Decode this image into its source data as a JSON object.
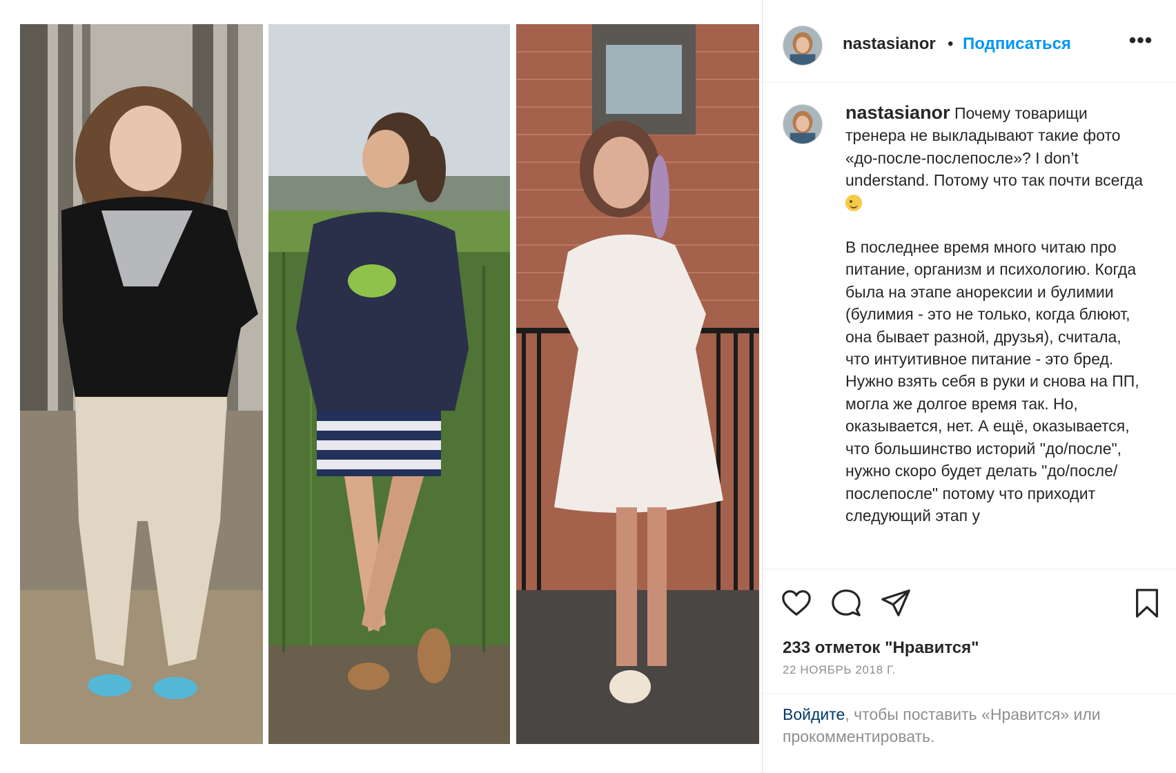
{
  "post": {
    "username": "nastasianor",
    "separator": "•",
    "follow_label": "Подписаться",
    "more_icon": "more-options-icon",
    "more_label": "•••"
  },
  "photos": [
    {
      "name": "photo-before",
      "background": "#8a7f6f"
    },
    {
      "name": "photo-after",
      "background": "#6b8a4e"
    },
    {
      "name": "photo-after-after",
      "background": "#9a5a48"
    }
  ],
  "caption": {
    "username": "nastasianor",
    "paragraph1": "Почему товарищи тренера не выкладывают такие фото «до-после-послепосле»? I don’t understand. Потому что так почти всегда",
    "emoji": "wink-emoji",
    "paragraph2": "В последнее время много читаю про питание, организм и психологию. Когда была на этапе анорексии и булимии (булимия - это не только, когда блюют, она бывает разной, друзья), считала, что интуитивное питание - это бред. Нужно взять себя в руки и снова на ПП, могла же долгое время так. Но, оказывается, нет. А ещё, оказывается, что большинство историй \"до/после\", нужно скоро будет делать \"до/после/послепосле\" потому что приходит следующий этап у"
  },
  "actions": {
    "icons": [
      "heart-icon",
      "comment-icon",
      "share-icon",
      "bookmark-icon"
    ],
    "likes": "233 отметок \"Нравится\"",
    "date": "22 НОЯБРЬ 2018 Г."
  },
  "login": {
    "link": "Войдите",
    "text": ", чтобы поставить «Нравится» или прокомментировать."
  },
  "colors": {
    "accent": "#0095f6",
    "link_dark": "#00376b",
    "text": "#262626",
    "muted": "#8e8e8e",
    "border": "#dbdbdb"
  }
}
